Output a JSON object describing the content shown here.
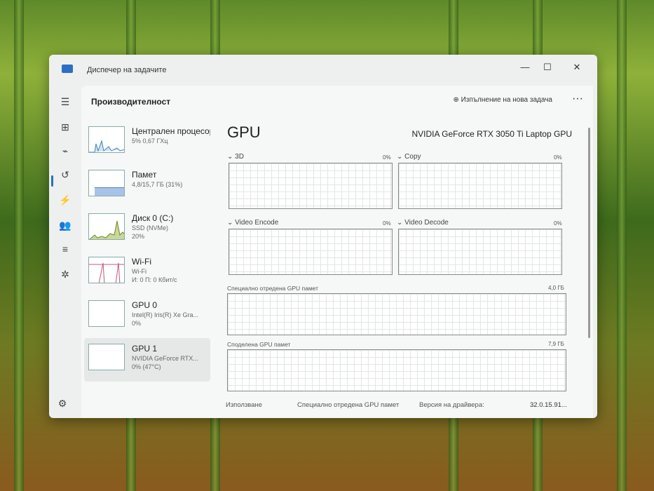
{
  "window": {
    "title": "Диспечер на задачите",
    "minimize": "—",
    "maximize": "☐",
    "close": "✕"
  },
  "header": {
    "title": "Производителност",
    "new_task": "Изпълнение на нова задача",
    "more": "···"
  },
  "sidebar": [
    {
      "name": "Централен процесор",
      "line1": "5% 0,67 ГХц",
      "line2": ""
    },
    {
      "name": "Памет",
      "line1": "4,8/15,7 ГБ (31%)",
      "line2": ""
    },
    {
      "name": "Диск 0 (C:)",
      "line1": "SSD (NVMe)",
      "line2": "20%"
    },
    {
      "name": "Wi-Fi",
      "line1": "Wi-Fi",
      "line2": "И: 0 П: 0 Кбит/с"
    },
    {
      "name": "GPU 0",
      "line1": "Intel(R) Iris(R) Xe Gra...",
      "line2": "0%"
    },
    {
      "name": "GPU 1",
      "line1": "NVIDIA GeForce RTX...",
      "line2": "0% (47°C)"
    }
  ],
  "main": {
    "title": "GPU",
    "model": "NVIDIA GeForce RTX 3050 Ti Laptop GPU",
    "engines": [
      {
        "label": "3D",
        "value": "0%"
      },
      {
        "label": "Copy",
        "value": "0%"
      },
      {
        "label": "Video Encode",
        "value": "0%"
      },
      {
        "label": "Video Decode",
        "value": "0%"
      }
    ],
    "dedicated": {
      "label": "Специално отредена GPU памет",
      "value": "4,0 ГБ"
    },
    "shared": {
      "label": "Споделена GPU памет",
      "value": "7,9 ГБ"
    },
    "footer": {
      "usage": "Използване",
      "dedicated": "Специално отредена GPU памет",
      "driver_label": "Версия на драйвера:",
      "driver_value": "32.0.15.91..."
    }
  }
}
